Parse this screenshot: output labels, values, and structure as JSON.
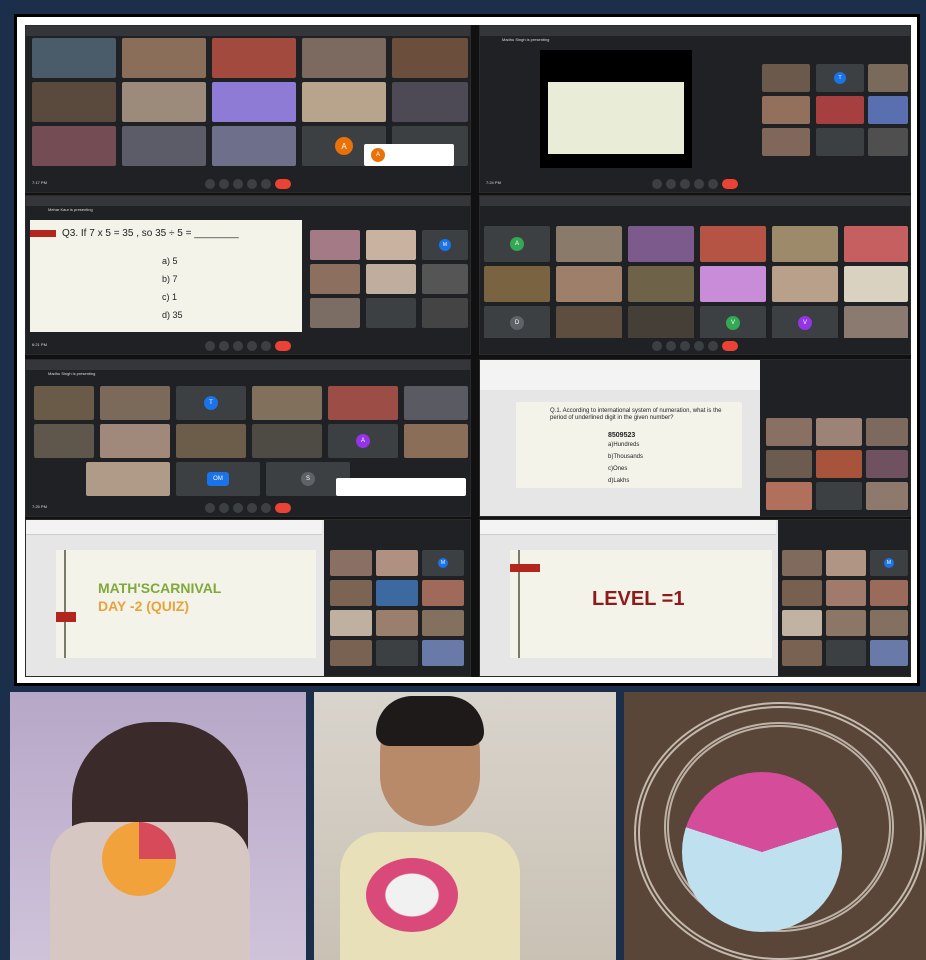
{
  "panel_meeting_1": {
    "avatar_a": "A",
    "avatar_a2": "A",
    "time": "7:17 PM"
  },
  "panel_meeting_2": {
    "presenter": "Madhu Singh is presenting",
    "time": "7:24 PM",
    "avatar_t": "T"
  },
  "panel_quiz_q3": {
    "presenter": "Mehar Kaur is presenting",
    "question": "Q3. If 7 x 5 = 35 , so  35 ÷ 5 = ________",
    "options": [
      "a)  5",
      "b) 7",
      "c) 1",
      "d) 35"
    ],
    "avatar_m": "M",
    "time": "6:21 PM"
  },
  "panel_grid_4": {
    "avatars": [
      "A",
      "D",
      "V",
      "V"
    ]
  },
  "panel_meeting_5": {
    "presenter": "Madhu Singh is presenting",
    "avatars": [
      "T",
      "A",
      "OM",
      "S"
    ],
    "time": "7:25 PM"
  },
  "panel_quiz_q1": {
    "question": "Q.1. According to international system of numeration, what is the period of underlined digit in the given number?",
    "number": "8509523",
    "options": [
      "a)Hundreds",
      "b)Thousands",
      "c)Ones",
      "d)Lakhs"
    ]
  },
  "panel_title_slide": {
    "line1": "MATH'SCARNIVAL",
    "line2": "DAY -2 (QUIZ)",
    "avatar_m": "M"
  },
  "panel_level_slide": {
    "title": "LEVEL =1",
    "avatar_m": "M"
  },
  "colors": {
    "meet_bg": "#202124",
    "slide_bg": "#f4f3ea",
    "accent_red": "#b3261e",
    "title_green": "#7fa93a",
    "title_orange": "#e8a33c",
    "level_red": "#8e1b1b"
  }
}
